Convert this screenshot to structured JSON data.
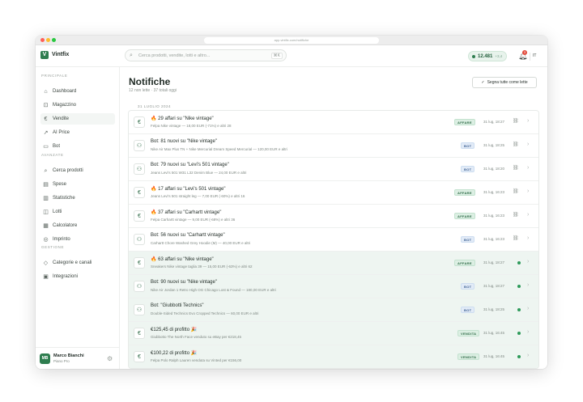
{
  "browser": {
    "url": "app.vintfix.com/notifiche",
    "dots": [
      "#ff5f57",
      "#febc2e",
      "#28c840"
    ]
  },
  "app": {
    "name": "Vintfix",
    "logo_letter": "V"
  },
  "search": {
    "placeholder": "Cerca prodotti, vendite, lotti e altro...",
    "shortcut": "⌘K"
  },
  "wallet": {
    "amount": "12.481",
    "change": "+3,4"
  },
  "notifications_badge": "3",
  "user_initials": "IT",
  "sidebar": {
    "sections": [
      {
        "title": "PRINCIPALE",
        "items": [
          {
            "label": "Dashboard",
            "icon": "home-icon",
            "glyph": "⌂"
          },
          {
            "label": "Magazzino",
            "icon": "box-icon",
            "glyph": "⊡"
          },
          {
            "label": "Vendite",
            "icon": "sales-icon",
            "glyph": "€"
          },
          {
            "label": "AI Price",
            "icon": "chart-icon",
            "glyph": "↗"
          },
          {
            "label": "Bot",
            "icon": "bot-icon",
            "glyph": "▭"
          }
        ]
      },
      {
        "title": "AVANZATE",
        "items": [
          {
            "label": "Cerca prodotti",
            "icon": "search-icon",
            "glyph": "⌕"
          },
          {
            "label": "Spese",
            "icon": "receipt-icon",
            "glyph": "▤"
          },
          {
            "label": "Statistiche",
            "icon": "stats-icon",
            "glyph": "▥"
          },
          {
            "label": "Lotti",
            "icon": "layers-icon",
            "glyph": "◫"
          },
          {
            "label": "Calcolatore",
            "icon": "calculator-icon",
            "glyph": "▦"
          },
          {
            "label": "Imprinto",
            "icon": "shield-icon",
            "glyph": "◎"
          }
        ]
      },
      {
        "title": "GESTIONE",
        "items": [
          {
            "label": "Categorie e canali",
            "icon": "tag-icon",
            "glyph": "◇"
          },
          {
            "label": "Integrazioni",
            "icon": "plug-icon",
            "glyph": "▣"
          }
        ]
      }
    ]
  },
  "user": {
    "name": "Marco Bianchi",
    "plan": "Piano Pro",
    "initials": "MB"
  },
  "page": {
    "title": "Notifiche",
    "subtitle": "12 non lette · 37 totali oggi",
    "mark_all": "Segna tutte come lette",
    "date_label": "31 LUGLIO 2024"
  },
  "notifications": [
    {
      "icon": "€",
      "title": "🔥 29 affari su \"Nike vintage\"",
      "subtitle": "Felpa Nike vintage — 18,00 EUR (-71%) e altri 28",
      "badge": "AFFARE",
      "badge_type": "green",
      "time": "31 lug, 18:27",
      "unread": false
    },
    {
      "icon": "⚇",
      "title": "Bot: 81 nuovi su \"Nike vintage\"",
      "subtitle": "Nike Air Max Plus TN + Nike Mercurial Dream Speed Mercurial — 120,00 EUR e altri",
      "badge": "BOT",
      "badge_type": "blue",
      "time": "31 lug, 18:25",
      "unread": false
    },
    {
      "icon": "⚇",
      "title": "Bot: 79 nuovi su \"Levi's 501 vintage\"",
      "subtitle": "Jeans Levi's 501 W31 L32 Denim Blue — 24,00 EUR e altri",
      "badge": "BOT",
      "badge_type": "blue",
      "time": "31 lug, 18:20",
      "unread": false
    },
    {
      "icon": "€",
      "title": "🔥 17 affari su \"Levi's 501 vintage\"",
      "subtitle": "Jeans Levi's 501 straight leg — 7,00 EUR (-60%) e altri 16",
      "badge": "AFFARE",
      "badge_type": "green",
      "time": "31 lug, 16:23",
      "unread": false
    },
    {
      "icon": "€",
      "title": "🔥 37 affari su \"Carhartt vintage\"",
      "subtitle": "Felpa Carhartt vintage — 9,00 EUR (-68%) e altri 36",
      "badge": "AFFARE",
      "badge_type": "green",
      "time": "31 lug, 16:23",
      "unread": false
    },
    {
      "icon": "⚇",
      "title": "Bot: 56 nuovi su \"Carhartt vintage\"",
      "subtitle": "Carhartt Chore Washed Grey Hoodie (M) — 40,00 EUR e altri",
      "badge": "BOT",
      "badge_type": "blue",
      "time": "31 lug, 16:23",
      "unread": false
    },
    {
      "icon": "€",
      "title": "🔥 63 affari su \"Nike vintage\"",
      "subtitle": "Sneakers Nike vintage taglia 39 — 15,00 EUR (-63%) e altri 62",
      "badge": "AFFARE",
      "badge_type": "green",
      "time": "31 lug, 18:27",
      "unread": true
    },
    {
      "icon": "⚇",
      "title": "Bot: 90 nuovi su \"Nike vintage\"",
      "subtitle": "Nike Air Jordan 1 Retro High OG Chicago Lost & Found — 180,00 EUR e altri",
      "badge": "BOT",
      "badge_type": "blue",
      "time": "31 lug, 18:27",
      "unread": true
    },
    {
      "icon": "⚇",
      "title": "Bot: \"Giubbotti Technics\"",
      "subtitle": "Double-Sided Technics Evo Cropped Technics — 60,00 EUR e altri",
      "badge": "BOT",
      "badge_type": "blue",
      "time": "31 lug, 18:25",
      "unread": true
    },
    {
      "icon": "€",
      "title": "€125,45 di profitto 🎉",
      "subtitle": "Giubbotto The North Face venduto su eBay per €218,45",
      "badge": "VENDITA",
      "badge_type": "green",
      "time": "31 lug, 16:45",
      "unread": true
    },
    {
      "icon": "€",
      "title": "€100,22 di profitto 🎉",
      "subtitle": "Felpa Polo Ralph Lauren venduta su Vinted per €156,00",
      "badge": "VENDITA",
      "badge_type": "green",
      "time": "31 lug, 16:45",
      "unread": true
    }
  ],
  "colors": {
    "accent": "#2e7d4f",
    "unread_bg": "#eef5f1",
    "danger": "#e24a3b"
  }
}
